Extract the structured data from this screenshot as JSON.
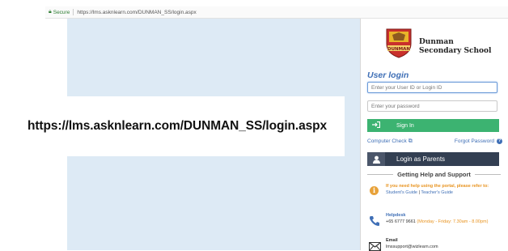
{
  "browser": {
    "secure_label": "Secure",
    "url": "https://lms.asknlearn.com/DUNMAN_SS/login.aspx"
  },
  "overlay": {
    "url_text": "https://lms.asknlearn.com/DUNMAN_SS/login.aspx"
  },
  "school": {
    "crest_text": "DUNMAN",
    "name_line1": "Dunman",
    "name_line2": "Secondary School"
  },
  "login": {
    "title": "User login",
    "user_placeholder": "Enter your User ID or Login ID",
    "password_placeholder": "Enter your password",
    "signin_label": "Sign In",
    "computer_check": "Computer Check",
    "forgot_password": "Forgot Password",
    "parents_label": "Login as Parents"
  },
  "help": {
    "heading": "Getting Help and Support",
    "intro": "If you need help using the portal, please refer to:",
    "students_guide": "Student's Guide",
    "divider": "|",
    "teachers_guide": "Teacher's Guide",
    "helpdesk_label": "Helpdesk",
    "helpdesk_phone": "+65 6777 9661",
    "helpdesk_hours": "(Monday - Friday: 7.30am - 8.00pm)",
    "email_label": "Email",
    "email_address": "lmssupport@wizlearn.com"
  },
  "colors": {
    "accent_blue": "#3f6fb6",
    "signin_green": "#3cb371",
    "parents_dark": "#333f52",
    "help_orange": "#e8931f",
    "page_bg": "#ddeaf5"
  }
}
